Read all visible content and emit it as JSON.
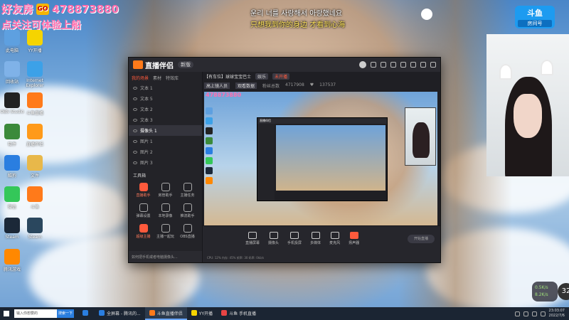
{
  "overlay": {
    "promo_line1": "好友房",
    "promo_line1_number": "478873880",
    "promo_line2": "点关注可体验上船",
    "chat_line1": "운리 너를 사랑해서 아랑했네요",
    "chat_line2": "只想我到你的身边 才看到心海"
  },
  "desktop_icons": [
    {
      "label": "此电脑",
      "color": "#5ea0e0"
    },
    {
      "label": "YY开播",
      "color": "#f5d400"
    },
    {
      "label": "回收站",
      "color": "#7fb2e8"
    },
    {
      "label": "Internet Explorer",
      "color": "#3ca1e8"
    },
    {
      "label": "OBS Studio",
      "color": "#222222"
    },
    {
      "label": "斗鱼直播",
      "color": "#ff7a1a"
    },
    {
      "label": "软件",
      "color": "#3b8a3b"
    },
    {
      "label": "直播伴侣",
      "color": "#ff9a1a"
    },
    {
      "label": "酷狗",
      "color": "#2a7ee0"
    },
    {
      "label": "文件",
      "color": "#e8b84a"
    },
    {
      "label": "微信",
      "color": "#34c759"
    },
    {
      "label": "斗鱼",
      "color": "#ff7a1a"
    },
    {
      "label": "Steam",
      "color": "#1b2838"
    },
    {
      "label": "Steam",
      "color": "#2a475e"
    },
    {
      "label": "腾讯游戏",
      "color": "#ff8800"
    }
  ],
  "app": {
    "title": "直播伴侣",
    "version": "新版",
    "tabs": [
      "我的场景",
      "素材",
      "特效库"
    ],
    "scenes": [
      {
        "label": "文本 1",
        "selected": false
      },
      {
        "label": "文本 5",
        "selected": false
      },
      {
        "label": "文本 2",
        "selected": false
      },
      {
        "label": "文本 3",
        "selected": false
      },
      {
        "label": "摄像头 1",
        "selected": true
      },
      {
        "label": "图片 1",
        "selected": false
      },
      {
        "label": "图片 2",
        "selected": false
      },
      {
        "label": "图片 3",
        "selected": false
      }
    ],
    "tools_title": "工具箱",
    "tools": [
      {
        "label": "直播助手",
        "highlight": true
      },
      {
        "label": "房管助手",
        "highlight": false
      },
      {
        "label": "主播任务",
        "highlight": false
      },
      {
        "label": "弹幕设置",
        "highlight": false
      },
      {
        "label": "本地录像",
        "highlight": false
      },
      {
        "label": "推流助手",
        "highlight": false
      },
      {
        "label": "超级主播",
        "highlight": true
      },
      {
        "label": "主播一起玩",
        "highlight": false
      },
      {
        "label": "OBS直播",
        "highlight": false
      }
    ],
    "footer_tip": "如何把手机或者电脑摄像头...",
    "room": {
      "title": "【有车位】球球宝宝巴士",
      "category": "娱乐",
      "status": "未开播",
      "r2_btn1": "高上镜人员",
      "r2_btn2": "观看数据",
      "fans_label": "粉丝总数",
      "fans": "4717908",
      "followers": "137537"
    },
    "bottom_bar": [
      {
        "label": "直播屏幕",
        "red": false
      },
      {
        "label": "摄像头",
        "red": false
      },
      {
        "label": "手机投屏",
        "red": false
      },
      {
        "label": "多媒体",
        "red": false
      },
      {
        "label": "麦克风",
        "red": false
      },
      {
        "label": "扬声器",
        "red": true
      }
    ],
    "start_live": "开始直播",
    "status_line": "CPU: 12%   内存: 45%   帧率: 30   码率: 0kb/s"
  },
  "right_panel": {
    "room_badge_brand": "斗鱼",
    "room_badge_label": "房间号"
  },
  "speed": {
    "up": "0.5K/s",
    "down": "8.2K/s"
  },
  "badge_count": "32",
  "taskbar": {
    "search_placeholder": "输入你想要的",
    "search_btn": "搜索一下",
    "apps": [
      {
        "label": "",
        "color": "#2a7ee0",
        "active": false
      },
      {
        "label": "全屏幕 - 腾讯的...",
        "color": "#2a7ee0",
        "active": false
      },
      {
        "label": "斗鱼直播伴侣",
        "color": "#ff7a1a",
        "active": true
      },
      {
        "label": "YY开播",
        "color": "#f5d400",
        "active": false
      },
      {
        "label": "斗鱼 手机直播",
        "color": "#e84444",
        "active": false
      }
    ],
    "time": "23:03:07",
    "date": "2022/7/6"
  }
}
